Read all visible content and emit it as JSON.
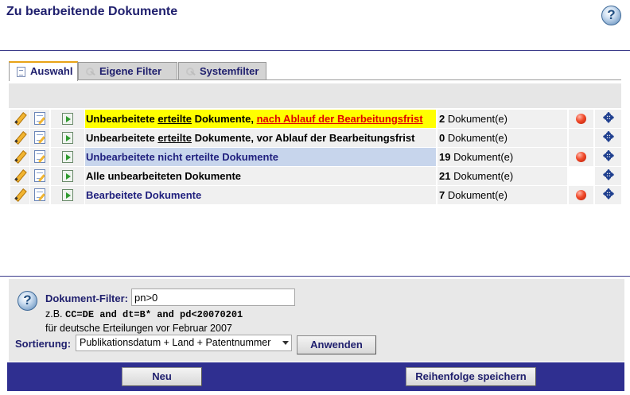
{
  "header": {
    "title": "Zu bearbeitende Dokumente",
    "help_icon": "?"
  },
  "tabs": [
    {
      "label": "Auswahl",
      "icon": "document-icon",
      "active": true
    },
    {
      "label": "Eigene Filter",
      "icon": "key-icon",
      "active": false
    },
    {
      "label": "Systemfilter",
      "icon": "key-icon",
      "active": false
    }
  ],
  "rows": [
    {
      "label_parts": [
        "Unbearbeitete ",
        "erteilte",
        " Dokumente, ",
        "nach Ablauf der Bearbeitungsfrist"
      ],
      "count": "2",
      "unit": " Dokument(e)",
      "status": "red-dot",
      "highlight": "#ffff00"
    },
    {
      "label_parts": [
        "Unbearbeitete ",
        "erteilte",
        " Dokumente, vor Ablauf der Bearbeitungsfrist"
      ],
      "count": "0",
      "unit": " Dokument(e)",
      "status": "none"
    },
    {
      "label": "Unbearbeitete nicht erteilte Dokumente",
      "count": "19",
      "unit": " Dokument(e)",
      "status": "red-dot",
      "highlight": "#c7d5ec"
    },
    {
      "label": "Alle unbearbeiteten Dokumente",
      "count": "21",
      "unit": " Dokument(e)",
      "status": "none"
    },
    {
      "label": "Bearbeitete Dokumente",
      "count": "7",
      "unit": " Dokument(e)",
      "status": "red-dot"
    }
  ],
  "row_icons": {
    "edit": "pencil-icon",
    "notes": "notepad-icon",
    "export": "export-arrow-icon",
    "move": "move-cross-icon",
    "status": "red-dot-icon"
  },
  "filter": {
    "label": "Dokument-Filter:",
    "value": "pn>0",
    "hint_prefix": "z.B. ",
    "hint_example": "CC=DE and dt=B* and pd<20070201",
    "hint_desc": "für deutsche Erteilungen vor Februar 2007",
    "help_icon": "?"
  },
  "sort": {
    "label": "Sortierung:",
    "selected": "Publikationsdatum + Land + Patentnummer",
    "apply_label": "Anwenden"
  },
  "footer": {
    "new_label": "Neu",
    "save_order_label": "Reihenfolge speichern"
  },
  "colors": {
    "title": "#20206e",
    "highlight_yellow": "#ffff00",
    "highlight_blue": "#c7d5ec",
    "overdue_red": "#e00000",
    "footer_bar": "#2f2f90"
  }
}
